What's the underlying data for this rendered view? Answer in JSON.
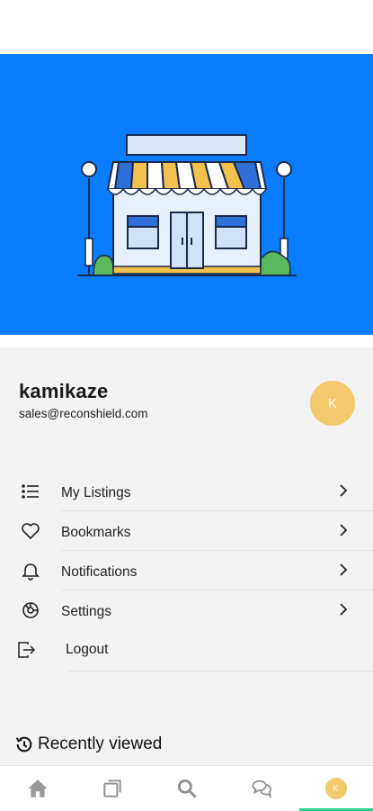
{
  "profile": {
    "username": "kamikaze",
    "email": "sales@reconshield.com",
    "avatar_initial": "K"
  },
  "menu": {
    "items": [
      {
        "label": "My Listings",
        "icon": "list-icon"
      },
      {
        "label": "Bookmarks",
        "icon": "heart-icon"
      },
      {
        "label": "Notifications",
        "icon": "bell-icon"
      },
      {
        "label": "Settings",
        "icon": "gear-icon"
      }
    ],
    "logout_label": "Logout"
  },
  "recently_viewed": {
    "label": "Recently viewed"
  },
  "bottom_nav": {
    "items": [
      "home-icon",
      "listings-icon",
      "search-icon",
      "chat-icon",
      "profile-avatar"
    ],
    "avatar_initial": "K",
    "active_index": 4
  },
  "colors": {
    "hero_background": "#0a7cff",
    "avatar": "#f2c96b",
    "active_indicator": "#2ecc8f"
  }
}
